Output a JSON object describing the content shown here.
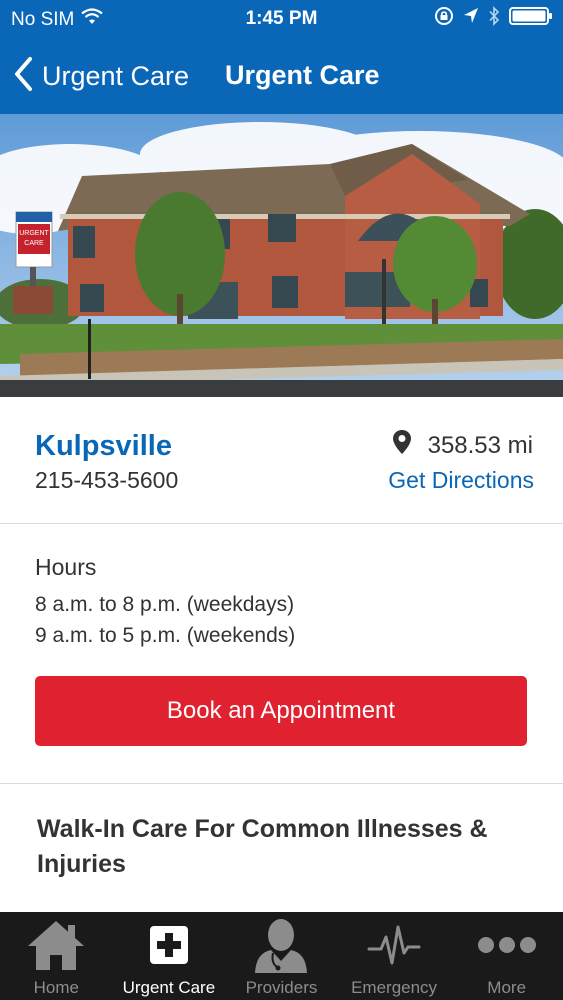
{
  "status_bar": {
    "carrier": "No SIM",
    "time": "1:45 PM"
  },
  "nav": {
    "back_label": "Urgent Care",
    "title": "Urgent Care"
  },
  "location": {
    "name": "Kulpsville",
    "phone": "215-453-5600",
    "distance": "358.53 mi",
    "directions_label": "Get Directions"
  },
  "hours": {
    "title": "Hours",
    "weekdays": "8 a.m. to 8 p.m. (weekdays)",
    "weekends": "9 a.m. to 5 p.m. (weekends)"
  },
  "book_button_label": "Book an Appointment",
  "services_title": "Walk-In Care For Common Illnesses & Injuries",
  "hero_sign": {
    "line1": "URGENT",
    "line2": "CARE"
  },
  "tabs": [
    {
      "label": "Home",
      "icon": "home-icon",
      "active": false
    },
    {
      "label": "Urgent Care",
      "icon": "urgent-care-icon",
      "active": true
    },
    {
      "label": "Providers",
      "icon": "providers-icon",
      "active": false
    },
    {
      "label": "Emergency",
      "icon": "heartbeat-icon",
      "active": false
    },
    {
      "label": "More",
      "icon": "more-icon",
      "active": false
    }
  ],
  "colors": {
    "brand_blue": "#0a67b8",
    "book_red": "#e0212f",
    "tab_bar": "#1a1a1a"
  }
}
